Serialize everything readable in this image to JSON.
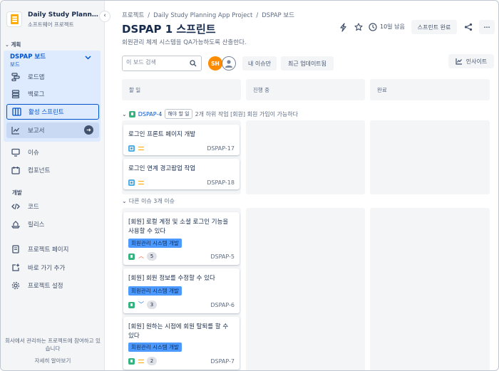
{
  "project": {
    "name": "Daily Study Planning App Project",
    "type": "소프트웨어 프로젝트"
  },
  "sidebar": {
    "planning_label": "계획",
    "board_title": "DSPAP 보드",
    "board_subtitle": "보드",
    "items": [
      {
        "label": "로드맵",
        "icon": "roadmap-icon"
      },
      {
        "label": "백로그",
        "icon": "backlog-icon"
      },
      {
        "label": "활성 스프린트",
        "icon": "board-icon"
      },
      {
        "label": "보고서",
        "icon": "chart-icon"
      },
      {
        "label": "이슈",
        "icon": "issues-icon"
      },
      {
        "label": "컴포넌트",
        "icon": "component-icon"
      }
    ],
    "dev_label": "개발",
    "dev_items": [
      {
        "label": "코드",
        "icon": "code-icon"
      },
      {
        "label": "릴리스",
        "icon": "release-icon"
      }
    ],
    "extra_items": [
      {
        "label": "프로젝트 페이지",
        "icon": "page-icon"
      },
      {
        "label": "바로 가기 추가",
        "icon": "add-shortcut-icon"
      },
      {
        "label": "프로젝트 설정",
        "icon": "settings-icon"
      }
    ],
    "footer_text": "회사에서 관리하는 프로젝트에 참여하고 있습니다",
    "footer_link": "자세히 알아보기"
  },
  "breadcrumb": [
    "프로젝트",
    "Daily Study Planning App Project",
    "DSPAP 보드"
  ],
  "sprint": {
    "title": "DSPAP 1 스프린트",
    "goal": "회원관리 체계 시스템을 QA가능하도록 산출한다.",
    "days_left": "10일 남음",
    "complete_label": "스프린트 완료",
    "more_label": "···"
  },
  "toolbar": {
    "search_placeholder": "이 보드 검색",
    "avatar_initials": "SH",
    "only_my_issues": "내 이슈만",
    "recently_updated": "최근 업데이트됨",
    "insights": "인사이트"
  },
  "columns": [
    "할 일",
    "진행 중",
    "완료"
  ],
  "swimlanes": [
    {
      "key": "DSPAP-4",
      "status": "해야 할 일",
      "summary": "2개 하위 작업 [회원] 회원 가입이 가능하다",
      "cards": [
        {
          "title": "로그인 프론트 페이지 개발",
          "key": "DSPAP-17"
        },
        {
          "title": "로그인 연계 경고팝업 작업",
          "key": "DSPAP-18"
        }
      ]
    },
    {
      "label": "다른 이슈 3개 이슈",
      "cards": [
        {
          "title": "[회원] 로컬 계정 및 소셜 로그인 기능을 사용할 수 있다",
          "epic": "회원관리 시스템 개발",
          "points": "5",
          "key": "DSPAP-5",
          "priority": "high"
        },
        {
          "title": "[회원] 회원 정보를 수정할 수 있다",
          "epic": "회원관리 시스템 개발",
          "points": "3",
          "key": "DSPAP-6",
          "priority": "low"
        },
        {
          "title": "[회원] 원하는 시점에 회원 탈퇴를 할 수 있다",
          "epic": "회원관리 시스템 개발",
          "points": "2",
          "key": "DSPAP-7",
          "priority": "medium"
        }
      ]
    }
  ],
  "colors": {
    "accent": "#0052cc",
    "sidebar_bg": "#f4f5f7",
    "active_bg": "#deebff",
    "epic": "#4c9aff",
    "avatar": "#ff8b00"
  }
}
